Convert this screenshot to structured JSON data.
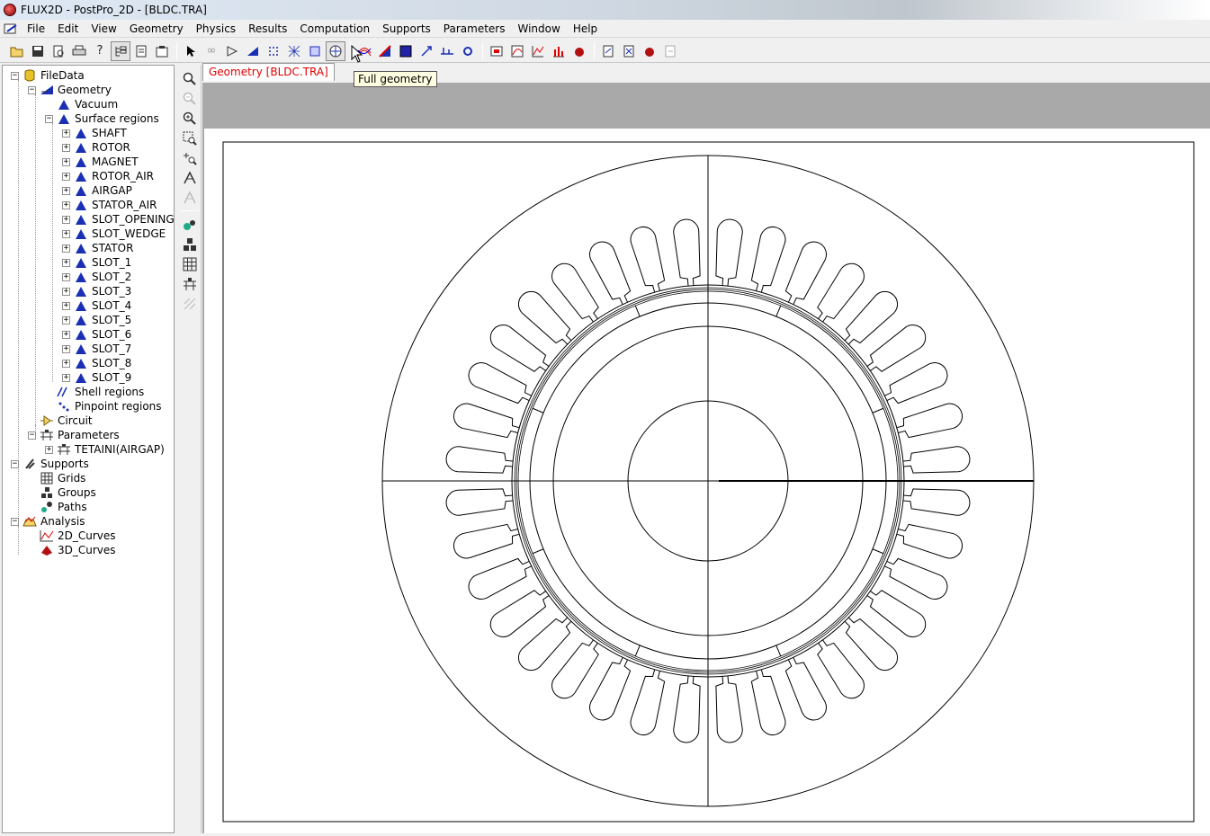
{
  "window": {
    "title": "FLUX2D - PostPro_2D - [BLDC.TRA]"
  },
  "menu": [
    "File",
    "Edit",
    "View",
    "Geometry",
    "Physics",
    "Results",
    "Computation",
    "Supports",
    "Parameters",
    "Window",
    "Help"
  ],
  "tooltip": "Full geometry",
  "doc_tab": "Geometry [BLDC.TRA]",
  "tree": {
    "root": "FileData",
    "geometry": "Geometry",
    "vacuum": "Vacuum",
    "surface_regions": "Surface regions",
    "regions": [
      "SHAFT",
      "ROTOR",
      "MAGNET",
      "ROTOR_AIR",
      "AIRGAP",
      "STATOR_AIR",
      "SLOT_OPENING",
      "SLOT_WEDGE",
      "STATOR",
      "SLOT_1",
      "SLOT_2",
      "SLOT_3",
      "SLOT_4",
      "SLOT_5",
      "SLOT_6",
      "SLOT_7",
      "SLOT_8",
      "SLOT_9"
    ],
    "shell_regions": "Shell regions",
    "pinpoint_regions": "Pinpoint regions",
    "circuit": "Circuit",
    "parameters": "Parameters",
    "tetaini": "TETAINI(AIRGAP)",
    "supports": "Supports",
    "grids": "Grids",
    "groups": "Groups",
    "paths": "Paths",
    "analysis": "Analysis",
    "curves_2d": "2D_Curves",
    "curves_3d": "3D_Curves"
  },
  "geometry_view": {
    "slot_count": 36,
    "slot_color": "#000000",
    "background": "#ffffff",
    "region_color": "#a9a9a9"
  },
  "colors": {
    "region_icon": "#1a2fb4",
    "tab_text": "#e00000",
    "tooltip_bg": "#ffffe1"
  }
}
